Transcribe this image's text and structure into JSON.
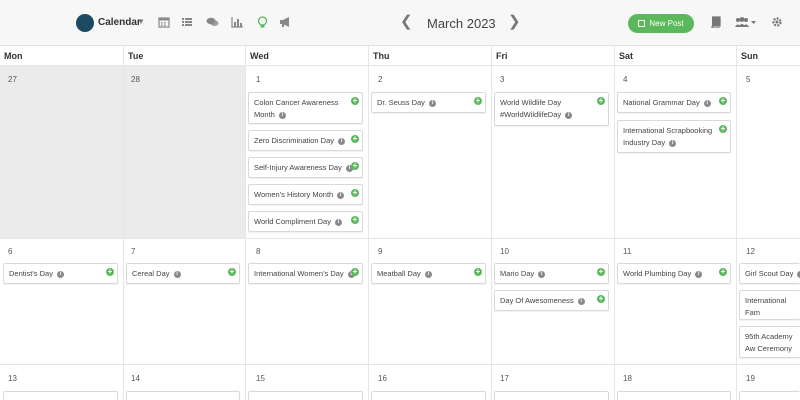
{
  "toolbar": {
    "calendar_label": "Calendar",
    "month_title": "March 2023",
    "new_post_label": "New Post",
    "prev_icon": "chevron-left",
    "next_icon": "chevron-right",
    "accent_color": "#5cb85c",
    "logo_color": "#1d4a63"
  },
  "weekdays": [
    "Mon",
    "Tue",
    "Wed",
    "Thu",
    "Fri",
    "Sat",
    "Sun"
  ],
  "weeks": [
    {
      "days": [
        {
          "num": "27",
          "past": true,
          "events": []
        },
        {
          "num": "28",
          "past": true,
          "events": []
        },
        {
          "num": "1",
          "events": [
            "Colon Cancer Awareness Month",
            "Zero Discrimination Day",
            "Self-Injury Awareness Day",
            "Women's History Month",
            "World Compliment Day"
          ]
        },
        {
          "num": "2",
          "events": [
            "Dr. Seuss Day"
          ]
        },
        {
          "num": "3",
          "events": [
            "World Wildlife Day #WorldWildlifeDay"
          ]
        },
        {
          "num": "4",
          "events": [
            "National Grammar Day",
            "International Scrapbooking Industry Day"
          ]
        },
        {
          "num": "5",
          "events": []
        }
      ]
    },
    {
      "days": [
        {
          "num": "6",
          "events": [
            "Dentist's Day"
          ]
        },
        {
          "num": "7",
          "events": [
            "Cereal Day"
          ]
        },
        {
          "num": "8",
          "events": [
            "International Women's Day"
          ]
        },
        {
          "num": "9",
          "events": [
            "Meatball Day"
          ]
        },
        {
          "num": "10",
          "events": [
            "Mario Day",
            "Day Of Awesomeness"
          ]
        },
        {
          "num": "11",
          "events": [
            "World Plumbing Day"
          ]
        },
        {
          "num": "12",
          "events": [
            "Girl Scout Day",
            "International Fam",
            "95th Academy Aw Ceremony"
          ]
        }
      ]
    },
    {
      "days": [
        {
          "num": "13",
          "events": []
        },
        {
          "num": "14",
          "events": []
        },
        {
          "num": "15",
          "events": []
        },
        {
          "num": "16",
          "events": []
        },
        {
          "num": "17",
          "events": []
        },
        {
          "num": "18",
          "events": []
        },
        {
          "num": "19",
          "events": []
        }
      ]
    }
  ]
}
